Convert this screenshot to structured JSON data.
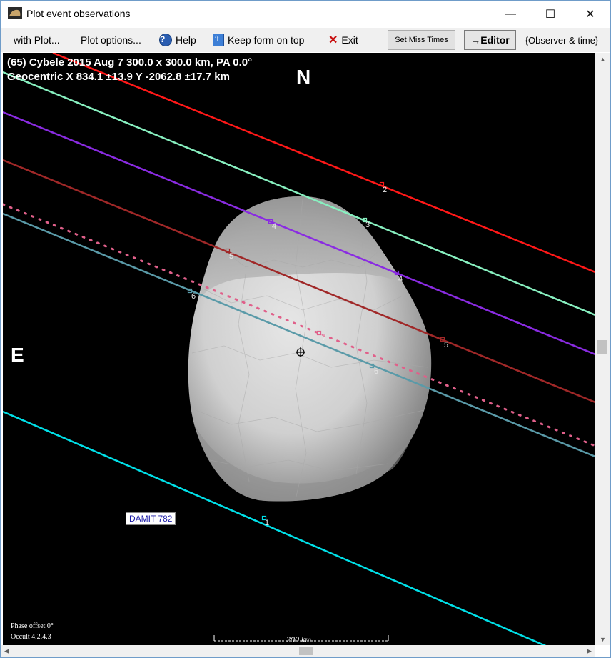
{
  "window": {
    "title": "Plot event observations",
    "minimize_glyph": "—",
    "maximize_glyph": "☐",
    "close_glyph": "✕"
  },
  "menu": {
    "with_plot": "with Plot...",
    "plot_options": "Plot options...",
    "help": "Help",
    "help_icon": "?",
    "keep_on_top": "Keep form on top",
    "keep_icon": "⇧",
    "exit": "Exit",
    "exit_icon": "✕",
    "set_miss_times": "Set Miss Times",
    "editor": "→Editor",
    "observer_time": "{Observer & time}"
  },
  "plot": {
    "header_line1": "(65) Cybele  2015 Aug 7   300.0 x 300.0 km, PA 0.0°",
    "header_line2": "Geocentric  X  834.1 ±13.9  Y -2062.8 ±17.7 km",
    "north": "N",
    "east": "E",
    "damit_label": "DAMIT 782",
    "phase_offset": "Phase offset 0°",
    "version": "Occult 4.2.4.3",
    "scale_label": "200 km",
    "background": "#000000",
    "shape_color": "#d6d6d6",
    "chords": [
      {
        "id": "1",
        "color": "#00e0e8",
        "style": "solid"
      },
      {
        "id": "2",
        "color": "#ff1818",
        "style": "solid"
      },
      {
        "id": "3",
        "color": "#88f0c0",
        "style": "solid"
      },
      {
        "id": "4",
        "color": "#8a2be2",
        "style": "solid"
      },
      {
        "id": "5",
        "color": "#a02828",
        "style": "solid"
      },
      {
        "id": "6",
        "color": "#5a9aa8",
        "style": "solid"
      },
      {
        "id": "7",
        "color": "#e0608a",
        "style": "dotted"
      }
    ],
    "chord_labels": [
      {
        "text": "1"
      },
      {
        "text": "2"
      },
      {
        "text": "3"
      },
      {
        "text": "4"
      },
      {
        "text": "4"
      },
      {
        "text": "5"
      },
      {
        "text": "5"
      },
      {
        "text": "6"
      },
      {
        "text": "6"
      },
      {
        "text": "7"
      }
    ]
  },
  "scroll": {
    "up": "▲",
    "down": "▼",
    "left": "◀",
    "right": "▶"
  }
}
